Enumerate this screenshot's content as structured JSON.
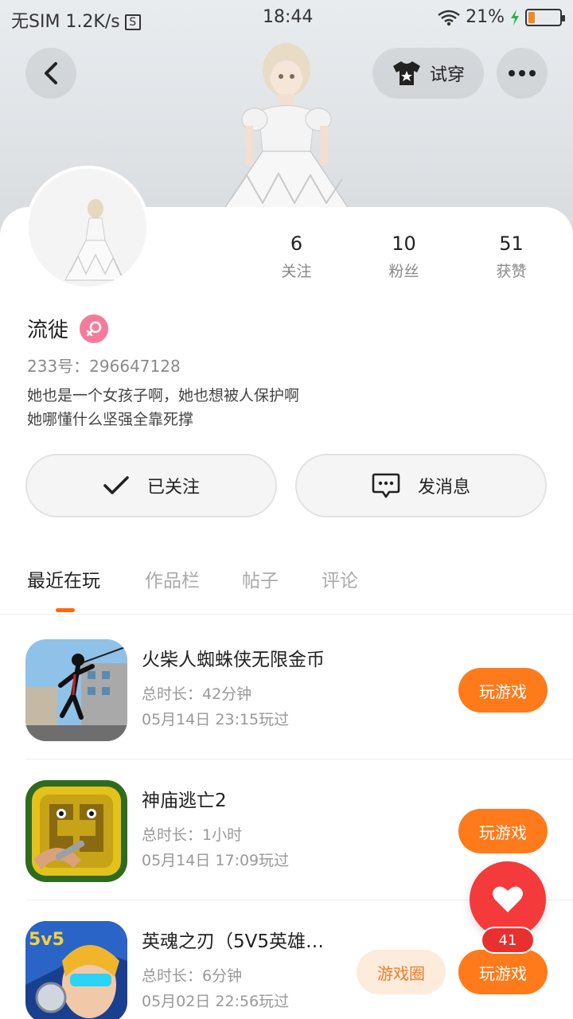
{
  "status_bar": {
    "carrier": "无SIM 1.2K/s",
    "sim_icon": "S",
    "time": "18:44",
    "battery": "21%",
    "battery_level": 0.21
  },
  "header": {
    "tryon_label": "试穿"
  },
  "profile": {
    "name": "流徙",
    "uid": "233号：296647128",
    "bio_line1": "她也是一个女孩子啊，她也想被人保护啊",
    "bio_line2": "她哪懂什么坚强全靠死撑",
    "stats": [
      {
        "num": "6",
        "label": "关注"
      },
      {
        "num": "10",
        "label": "粉丝"
      },
      {
        "num": "51",
        "label": "获赞"
      }
    ]
  },
  "actions": {
    "follow_label": "已关注",
    "message_label": "发消息"
  },
  "tabs": [
    "最近在玩",
    "作品栏",
    "帖子",
    "评论"
  ],
  "games": [
    {
      "title": "火柴人蜘蛛侠无限金币",
      "duration": "总时长：42分钟",
      "last_played": "05月14日  23:15玩过",
      "play_label": "玩游戏"
    },
    {
      "title": "神庙逃亡2",
      "duration": "总时长：1小时",
      "last_played": "05月14日  17:09玩过",
      "play_label": "玩游戏"
    },
    {
      "title": "英魂之刃（5V5英雄…",
      "duration": "总时长：6分钟",
      "last_played": "05月02日  22:56玩过",
      "play_label": "玩游戏",
      "circle_label": "游戏圈"
    }
  ],
  "like": {
    "count": "41"
  },
  "colors": {
    "accent": "#ff7a1a",
    "like": "#f43a3a",
    "gender": "#f67a9b"
  }
}
